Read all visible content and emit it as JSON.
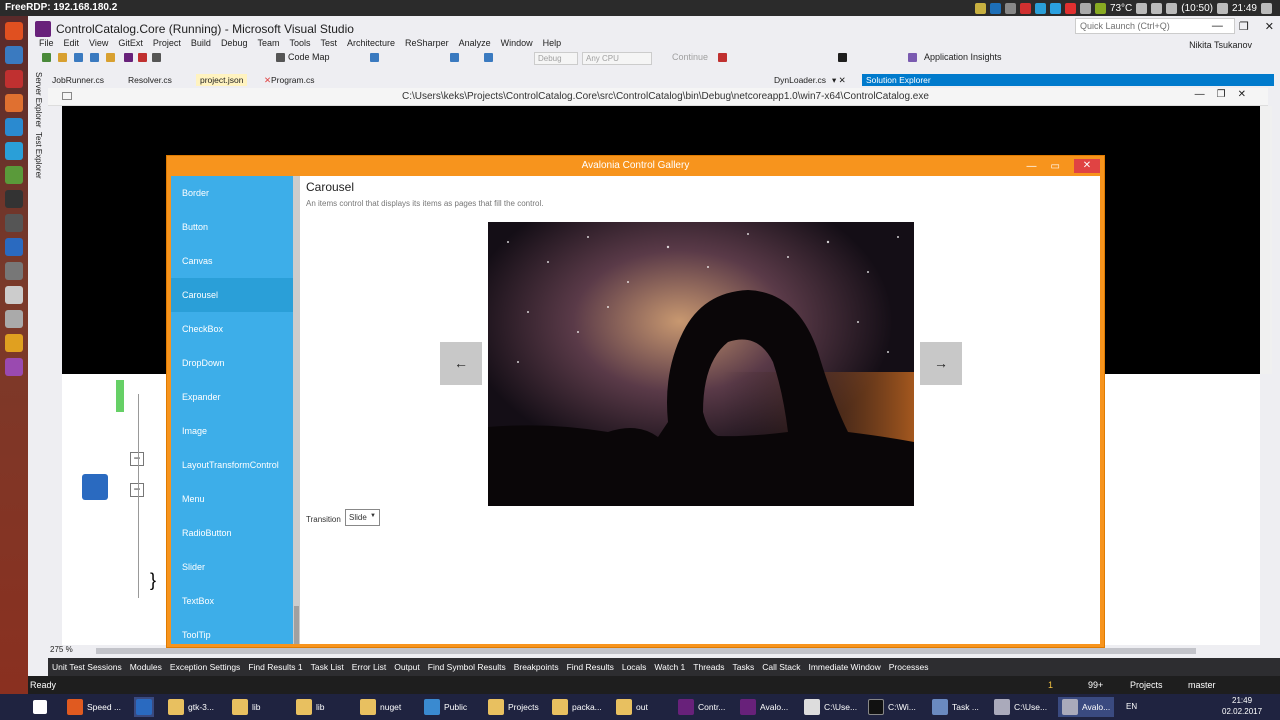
{
  "rdp": {
    "title": "FreeRDP: 192.168.180.2",
    "temp": "73°C",
    "battery": "(10:50)",
    "clock": "21:49"
  },
  "vs": {
    "title": "ControlCatalog.Core (Running) - Microsoft Visual Studio",
    "quick_launch_placeholder": "Quick Launch (Ctrl+Q)",
    "user": "Nikita Tsukanov",
    "menu": [
      "File",
      "Edit",
      "View",
      "GitExt",
      "Project",
      "Build",
      "Debug",
      "Team",
      "Tools",
      "Test",
      "Architecture",
      "ReSharper",
      "Analyze",
      "Window",
      "Help"
    ],
    "toolbar": {
      "code_map": "Code Map",
      "config": "Debug",
      "platform": "Any CPU",
      "continue": "Continue",
      "insights": "Application Insights"
    },
    "side_tabs": [
      "Server Explorer",
      "Test Explorer"
    ],
    "tabs": [
      "JobRunner.cs",
      "Resolver.cs",
      "project.json",
      "Program.cs"
    ],
    "right_tab": "DynLoader.cs",
    "solution_explorer": "Solution Explorer",
    "exe_path": "C:\\Users\\keks\\Projects\\ControlCatalog.Core\\src\\ControlCatalog\\bin\\Debug\\netcoreapp1.0\\win7-x64\\ControlCatalog.exe",
    "zoom": "275 %",
    "bottom_tabs": [
      "Unit Test Sessions",
      "Modules",
      "Exception Settings",
      "Find Results 1",
      "Task List",
      "Error List",
      "Output",
      "Find Symbol Results",
      "Breakpoints",
      "Find Results",
      "Locals",
      "Watch 1",
      "Threads",
      "Tasks",
      "Call Stack",
      "Immediate Window",
      "Processes"
    ],
    "status": {
      "ready": "Ready",
      "errors": "1",
      "warnings": "99+",
      "projects": "Projects",
      "branch": "master"
    }
  },
  "avalonia": {
    "title": "Avalonia Control Gallery",
    "items": [
      "Border",
      "Button",
      "Canvas",
      "Carousel",
      "CheckBox",
      "DropDown",
      "Expander",
      "Image",
      "LayoutTransformControl",
      "Menu",
      "RadioButton",
      "Slider",
      "TextBox",
      "ToolTip"
    ],
    "selected": "Carousel",
    "page_title": "Carousel",
    "page_desc": "An items control that displays its items as pages that fill the control.",
    "transition_label": "Transition",
    "transition_value": "Slide"
  },
  "taskbar": {
    "items": [
      "Speed ...",
      "gtk-3...",
      "lib",
      "lib",
      "nuget",
      "Public",
      "Projects",
      "packa...",
      "out",
      "Contr...",
      "Avalo...",
      "C:\\Use...",
      "C:\\Wi...",
      "Task ...",
      "C:\\Use...",
      "Avalo..."
    ],
    "lang": "EN",
    "time": "21:49",
    "date": "02.02.2017"
  }
}
